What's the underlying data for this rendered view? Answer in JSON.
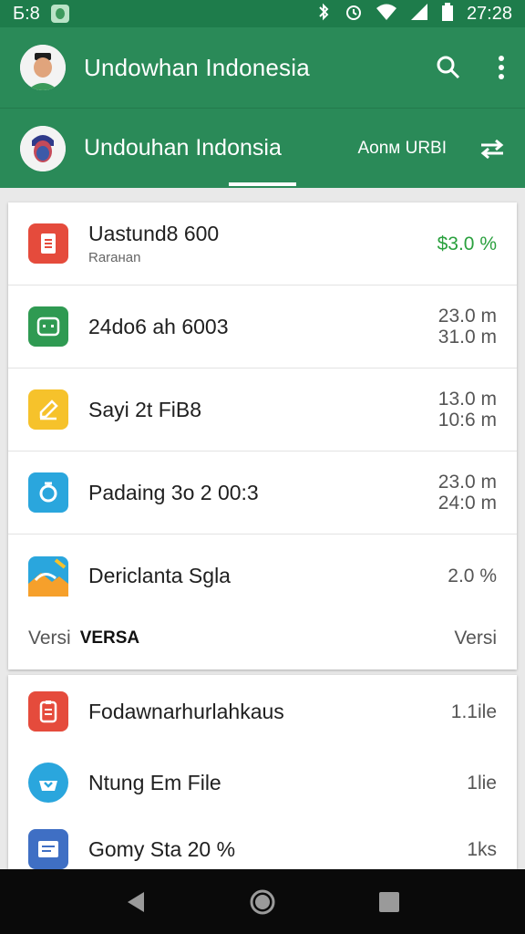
{
  "status_bar": {
    "time_left": "Б:8",
    "time_right": "27:28"
  },
  "app_bar": {
    "title": "Undowhan Indonesia"
  },
  "sub_bar": {
    "title": "Undouhan Indonsia",
    "right_label": "Aonм URBI"
  },
  "list1": [
    {
      "name": "Uastund8 600",
      "sub": "Raraнan",
      "meta": [
        "$3.0 %"
      ],
      "icon": "document-icon",
      "color": "#e54b3c"
    },
    {
      "name": "24do6 ah 6003",
      "meta": [
        "23.0 m",
        "31.0 m"
      ],
      "icon": "chat-icon",
      "color": "#2f9a52"
    },
    {
      "name": "Sayi 2t FiB8",
      "meta": [
        "13.0 m",
        "10:6 m"
      ],
      "icon": "edit-icon",
      "color": "#f6c22b"
    },
    {
      "name": "Padaing 3o 2 00:3",
      "meta": [
        "23.0 m",
        "24:0 m"
      ],
      "icon": "timer-icon",
      "color": "#2aa6dd"
    },
    {
      "name": "Dericlanta Sgla",
      "meta": [
        "2.0 %"
      ],
      "icon": "image-icon",
      "color": "#2aa6dd"
    }
  ],
  "footer": {
    "left": "Versi",
    "bold": "VERSA",
    "right": "Versi"
  },
  "list2": [
    {
      "name": "Fodawnarhurlahkaus",
      "meta": "1.1ile",
      "icon": "document-icon",
      "color": "#e54b3c"
    },
    {
      "name": "Ntung Em File",
      "meta": "1lie",
      "icon": "download-box-icon",
      "color": "#2aa6dd"
    },
    {
      "name": "Gomy Sta 20 %",
      "meta": "1ks",
      "icon": "notes-icon",
      "color": "#3f6fc4"
    }
  ]
}
